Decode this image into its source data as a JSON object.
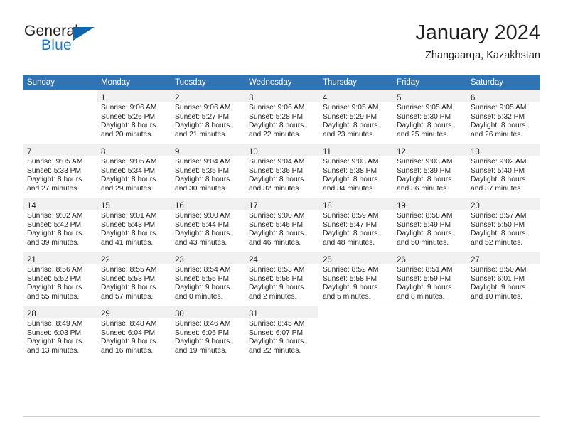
{
  "brand": {
    "name_top": "General",
    "name_bottom": "Blue",
    "accent_color": "#1878be",
    "triangle_color": "#1166ab"
  },
  "header": {
    "title": "January 2024",
    "subtitle": "Zhangaarqa, Kazakhstan"
  },
  "calendar": {
    "header_bg": "#3174b4",
    "header_text_color": "#ffffff",
    "daynum_band_bg": "#f1f1f1",
    "grid_line_color": "#d0d0d0",
    "weekdays": [
      "Sunday",
      "Monday",
      "Tuesday",
      "Wednesday",
      "Thursday",
      "Friday",
      "Saturday"
    ],
    "weeks": [
      [
        {
          "day": "",
          "lines": []
        },
        {
          "day": "1",
          "lines": [
            "Sunrise: 9:06 AM",
            "Sunset: 5:26 PM",
            "Daylight: 8 hours",
            "and 20 minutes."
          ]
        },
        {
          "day": "2",
          "lines": [
            "Sunrise: 9:06 AM",
            "Sunset: 5:27 PM",
            "Daylight: 8 hours",
            "and 21 minutes."
          ]
        },
        {
          "day": "3",
          "lines": [
            "Sunrise: 9:06 AM",
            "Sunset: 5:28 PM",
            "Daylight: 8 hours",
            "and 22 minutes."
          ]
        },
        {
          "day": "4",
          "lines": [
            "Sunrise: 9:05 AM",
            "Sunset: 5:29 PM",
            "Daylight: 8 hours",
            "and 23 minutes."
          ]
        },
        {
          "day": "5",
          "lines": [
            "Sunrise: 9:05 AM",
            "Sunset: 5:30 PM",
            "Daylight: 8 hours",
            "and 25 minutes."
          ]
        },
        {
          "day": "6",
          "lines": [
            "Sunrise: 9:05 AM",
            "Sunset: 5:32 PM",
            "Daylight: 8 hours",
            "and 26 minutes."
          ]
        }
      ],
      [
        {
          "day": "7",
          "lines": [
            "Sunrise: 9:05 AM",
            "Sunset: 5:33 PM",
            "Daylight: 8 hours",
            "and 27 minutes."
          ]
        },
        {
          "day": "8",
          "lines": [
            "Sunrise: 9:05 AM",
            "Sunset: 5:34 PM",
            "Daylight: 8 hours",
            "and 29 minutes."
          ]
        },
        {
          "day": "9",
          "lines": [
            "Sunrise: 9:04 AM",
            "Sunset: 5:35 PM",
            "Daylight: 8 hours",
            "and 30 minutes."
          ]
        },
        {
          "day": "10",
          "lines": [
            "Sunrise: 9:04 AM",
            "Sunset: 5:36 PM",
            "Daylight: 8 hours",
            "and 32 minutes."
          ]
        },
        {
          "day": "11",
          "lines": [
            "Sunrise: 9:03 AM",
            "Sunset: 5:38 PM",
            "Daylight: 8 hours",
            "and 34 minutes."
          ]
        },
        {
          "day": "12",
          "lines": [
            "Sunrise: 9:03 AM",
            "Sunset: 5:39 PM",
            "Daylight: 8 hours",
            "and 36 minutes."
          ]
        },
        {
          "day": "13",
          "lines": [
            "Sunrise: 9:02 AM",
            "Sunset: 5:40 PM",
            "Daylight: 8 hours",
            "and 37 minutes."
          ]
        }
      ],
      [
        {
          "day": "14",
          "lines": [
            "Sunrise: 9:02 AM",
            "Sunset: 5:42 PM",
            "Daylight: 8 hours",
            "and 39 minutes."
          ]
        },
        {
          "day": "15",
          "lines": [
            "Sunrise: 9:01 AM",
            "Sunset: 5:43 PM",
            "Daylight: 8 hours",
            "and 41 minutes."
          ]
        },
        {
          "day": "16",
          "lines": [
            "Sunrise: 9:00 AM",
            "Sunset: 5:44 PM",
            "Daylight: 8 hours",
            "and 43 minutes."
          ]
        },
        {
          "day": "17",
          "lines": [
            "Sunrise: 9:00 AM",
            "Sunset: 5:46 PM",
            "Daylight: 8 hours",
            "and 46 minutes."
          ]
        },
        {
          "day": "18",
          "lines": [
            "Sunrise: 8:59 AM",
            "Sunset: 5:47 PM",
            "Daylight: 8 hours",
            "and 48 minutes."
          ]
        },
        {
          "day": "19",
          "lines": [
            "Sunrise: 8:58 AM",
            "Sunset: 5:49 PM",
            "Daylight: 8 hours",
            "and 50 minutes."
          ]
        },
        {
          "day": "20",
          "lines": [
            "Sunrise: 8:57 AM",
            "Sunset: 5:50 PM",
            "Daylight: 8 hours",
            "and 52 minutes."
          ]
        }
      ],
      [
        {
          "day": "21",
          "lines": [
            "Sunrise: 8:56 AM",
            "Sunset: 5:52 PM",
            "Daylight: 8 hours",
            "and 55 minutes."
          ]
        },
        {
          "day": "22",
          "lines": [
            "Sunrise: 8:55 AM",
            "Sunset: 5:53 PM",
            "Daylight: 8 hours",
            "and 57 minutes."
          ]
        },
        {
          "day": "23",
          "lines": [
            "Sunrise: 8:54 AM",
            "Sunset: 5:55 PM",
            "Daylight: 9 hours",
            "and 0 minutes."
          ]
        },
        {
          "day": "24",
          "lines": [
            "Sunrise: 8:53 AM",
            "Sunset: 5:56 PM",
            "Daylight: 9 hours",
            "and 2 minutes."
          ]
        },
        {
          "day": "25",
          "lines": [
            "Sunrise: 8:52 AM",
            "Sunset: 5:58 PM",
            "Daylight: 9 hours",
            "and 5 minutes."
          ]
        },
        {
          "day": "26",
          "lines": [
            "Sunrise: 8:51 AM",
            "Sunset: 5:59 PM",
            "Daylight: 9 hours",
            "and 8 minutes."
          ]
        },
        {
          "day": "27",
          "lines": [
            "Sunrise: 8:50 AM",
            "Sunset: 6:01 PM",
            "Daylight: 9 hours",
            "and 10 minutes."
          ]
        }
      ],
      [
        {
          "day": "28",
          "lines": [
            "Sunrise: 8:49 AM",
            "Sunset: 6:03 PM",
            "Daylight: 9 hours",
            "and 13 minutes."
          ]
        },
        {
          "day": "29",
          "lines": [
            "Sunrise: 8:48 AM",
            "Sunset: 6:04 PM",
            "Daylight: 9 hours",
            "and 16 minutes."
          ]
        },
        {
          "day": "30",
          "lines": [
            "Sunrise: 8:46 AM",
            "Sunset: 6:06 PM",
            "Daylight: 9 hours",
            "and 19 minutes."
          ]
        },
        {
          "day": "31",
          "lines": [
            "Sunrise: 8:45 AM",
            "Sunset: 6:07 PM",
            "Daylight: 9 hours",
            "and 22 minutes."
          ]
        },
        {
          "day": "",
          "lines": []
        },
        {
          "day": "",
          "lines": []
        },
        {
          "day": "",
          "lines": []
        }
      ]
    ]
  }
}
